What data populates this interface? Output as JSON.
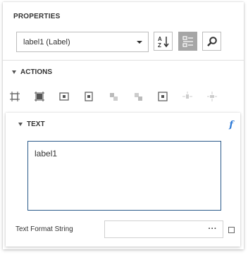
{
  "panel": {
    "title": "PROPERTIES",
    "selector": {
      "value": "label1 (Label)"
    },
    "toolbar": [
      {
        "name": "sort-alphabetical-icon",
        "active": false
      },
      {
        "name": "categorized-view-icon",
        "active": true
      },
      {
        "name": "search-icon",
        "active": false
      }
    ]
  },
  "actions": {
    "header": "ACTIONS",
    "icons": [
      "fit-bounds-to-container-icon",
      "fit-to-content-icon",
      "align-center-horizontal-icon",
      "align-center-vertical-icon",
      "bring-to-front-icon",
      "send-to-back-icon",
      "center-in-container-icon",
      "distribute-horizontal-icon",
      "distribute-vertical-icon"
    ]
  },
  "text_section": {
    "header": "TEXT",
    "expression_icon": "f",
    "text_value": "label1",
    "format_string_label": "Text Format String",
    "format_string_value": "",
    "ellipsis": "···"
  }
}
